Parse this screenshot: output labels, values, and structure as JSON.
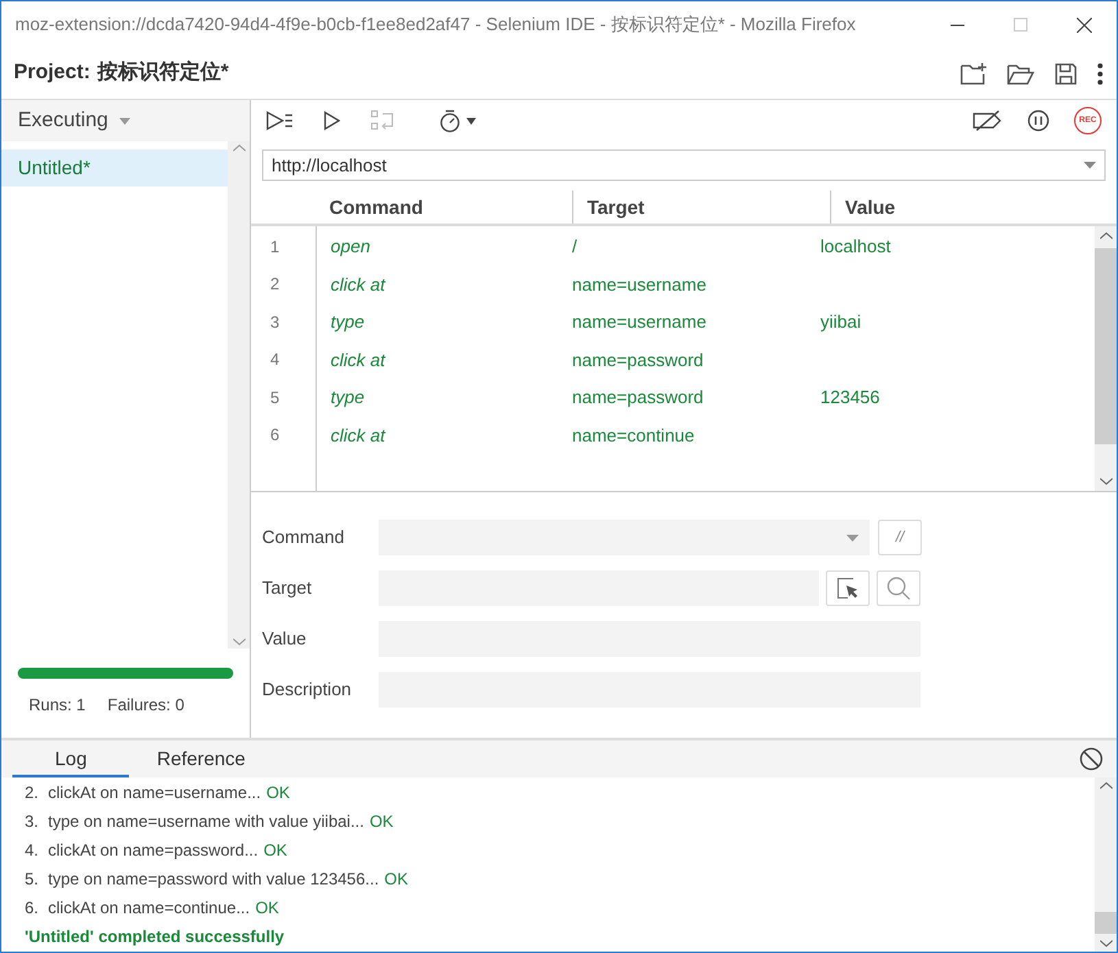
{
  "window": {
    "title": "moz-extension://dcda7420-94d4-4f9e-b0cb-f1ee8ed2af47 - Selenium IDE - 按标识符定位* - Mozilla Firefox"
  },
  "project": {
    "label": "Project:",
    "name": "按标识符定位*"
  },
  "sidebar": {
    "dropdown": "Executing",
    "tests": [
      {
        "name": "Untitled*",
        "selected": true
      }
    ],
    "progress": {
      "level": 1
    },
    "runs": "Runs: 1",
    "failures": "Failures: 0"
  },
  "toolbar": {
    "record_label": "REC"
  },
  "url": "http://localhost",
  "table": {
    "columns": [
      "Command",
      "Target",
      "Value"
    ],
    "rows": [
      {
        "index": "1",
        "command": "open",
        "target": "/",
        "value": "localhost",
        "passed": true
      },
      {
        "index": "2",
        "command": "click at",
        "target": "name=username",
        "value": "",
        "passed": true
      },
      {
        "index": "3",
        "command": "type",
        "target": "name=username",
        "value": "yiibai",
        "passed": true
      },
      {
        "index": "4",
        "command": "click at",
        "target": "name=password",
        "value": "",
        "passed": true
      },
      {
        "index": "5",
        "command": "type",
        "target": "name=password",
        "value": "123456",
        "passed": true
      },
      {
        "index": "6",
        "command": "click at",
        "target": "name=continue",
        "value": "",
        "passed": true
      }
    ]
  },
  "editor": {
    "labels": [
      "Command",
      "Target",
      "Value",
      "Description"
    ],
    "comment_button": "//"
  },
  "log": {
    "tabs": [
      {
        "label": "Log",
        "selected": true
      },
      {
        "label": "Reference",
        "selected": false
      }
    ],
    "entries": [
      {
        "number": "2.",
        "text": "clickAt on name=username...",
        "result": "OK"
      },
      {
        "number": "3.",
        "text": "type on name=username with value yiibai...",
        "result": "OK"
      },
      {
        "number": "4.",
        "text": "clickAt on name=password...",
        "result": "OK"
      },
      {
        "number": "5.",
        "text": "type on name=password with value 123456...",
        "result": "OK"
      },
      {
        "number": "6.",
        "text": "clickAt on name=continue...",
        "result": "OK"
      }
    ],
    "summary": "'Untitled' completed successfully"
  }
}
